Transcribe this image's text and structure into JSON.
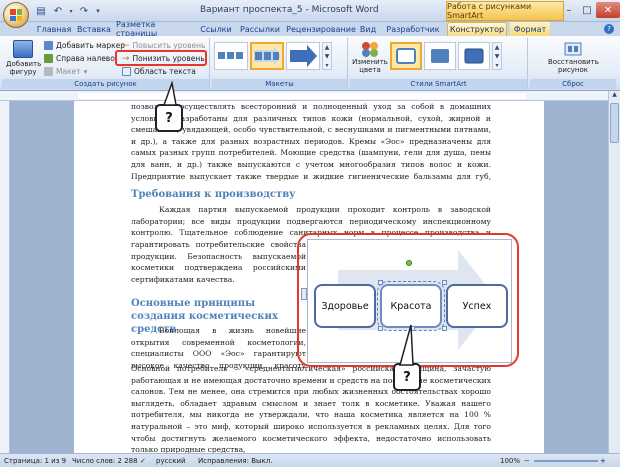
{
  "window": {
    "title": "Вариант проспекта_5 - Microsoft Word",
    "context_tab_title": "Работа с рисунками SmartArt"
  },
  "tabs": [
    "Главная",
    "Вставка",
    "Разметка страницы",
    "Ссылки",
    "Рассылки",
    "Рецензирование",
    "Вид",
    "Разработчик",
    "Конструктор",
    "Формат"
  ],
  "ribbon": {
    "create_group": {
      "add_shape": "Добавить фигуру",
      "add_bullet": "Добавить маркер",
      "right_to_left": "Справа налево",
      "layout": "Макет",
      "promote": "Повысить уровень",
      "demote": "Понизить уровень",
      "text_pane": "Область текста",
      "label": "Создать рисунок"
    },
    "layouts_label": "Макеты",
    "change_colors": "Изменить цвета",
    "styles_label": "Стили SmartArt",
    "reset_graphic": "Восстановить рисунок",
    "reset_label": "Сброс"
  },
  "document": {
    "para1": "позволяют осуществлять всесторонний и полноценный уход за собой в домашних условиях. Разработаны для различных типов кожи (нормальной, сухой, жирной и смешанной, увядающей, особо чувствительной, с веснушками и пигментными пятнами, и др.), а также для разных возрастных периодов. Кремы «Эос» предназначены для самых разных групп потребителей. Моющие средства (шампуни, гели для душа, пены для ванн, и др.) также выпускаются с учетом многообразия типов волос и кожи. Предприятие выпускает также твердые и жидкие гигиенические бальзамы для губ, серии продуктов специального назначения.",
    "heading1": "Требования к производству",
    "para2a": "Каждая партия выпускаемой продукции проходит контроль в заводской лаборатории; все виды продукции подвергаются периодическому инспекционному контролю. Тщательное соблюдение санитарных норм в процессе производства и высокие требования к персоналу позволяют",
    "para2b": "гарантировать потребительские свойства продукции. Безопасность выпускаемой косметики подтверждена российскими сертификатами качества.",
    "heading2": "Основные принципы создания косметических средств",
    "para3a": "Воплощая в жизнь новейшие открытия современной косметологии, специалисты ООО «Эос» гарантируют высокое качество продукции, красоту упаковки и изысканность стиля.",
    "para3b": "Основной потребитель – «среднестатистическая» российская женщина, зачастую работающая и не имеющая достаточно времени и средств на посещение косметических салонов. Тем не менее, она стремится при любых жизненных обстоятельствах хорошо выглядеть, обладает здравым смыслом и знает толк в косметике. Уважая нашего потребителя, мы никогда не утверждали, что наша косметика является на 100 % натуральной – это миф, который широко используется в рекламных целях. Для того чтобы достигнуть желаемого косметического эффекта, недостаточно использовать только природные средства,"
  },
  "smartart": {
    "boxes": [
      "Здоровье",
      "Красота",
      "Успех"
    ]
  },
  "callouts": [
    "?",
    "?"
  ],
  "status": {
    "page": "Страница: 1 из 9",
    "words": "Число слов: 2 288",
    "language": "русский",
    "track": "Исправления: Выкл.",
    "zoom": "100%"
  }
}
